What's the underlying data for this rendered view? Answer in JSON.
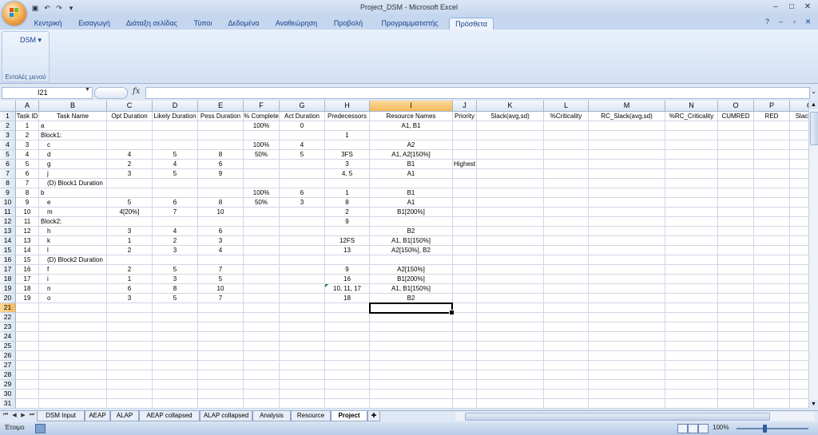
{
  "window": {
    "title": "Project_DSM - Microsoft Excel"
  },
  "ribbon": {
    "tabs": [
      "Κεντρική",
      "Εισαγωγή",
      "Διάταξη σελίδας",
      "Τύποι",
      "Δεδομένα",
      "Αναθεώρηση",
      "Προβολή",
      "Προγραμματιστής",
      "Πρόσθετα"
    ],
    "active_tab": "Πρόσθετα",
    "dsm_button": "DSM",
    "group_label": "Εντολές μενού"
  },
  "formula_bar": {
    "name_box": "I21",
    "fx": "fx",
    "formula": ""
  },
  "columns": [
    "A",
    "B",
    "C",
    "D",
    "E",
    "F",
    "G",
    "H",
    "I",
    "J",
    "K",
    "L",
    "M",
    "N",
    "O",
    "P",
    "Q"
  ],
  "selected_column": "I",
  "selected_row": 21,
  "row_count": 31,
  "rows": [
    [
      "Task ID",
      "Task Name",
      "Opt Duration",
      "Likely Duration",
      "Pess Duration",
      "% Complete",
      "Act Duration",
      "Predecessors",
      "Resource Names",
      "Priority",
      "Slack(avg,sd)",
      "%Criticality",
      "RC_Slack(avg,sd)",
      "%RC_Criticality",
      "CUMRED",
      "RED",
      "Slack/Suc"
    ],
    [
      "1",
      "a",
      "",
      "",
      "",
      "100%",
      "0",
      "",
      "A1, B1",
      "",
      "",
      "",
      "",
      "",
      "",
      "",
      ""
    ],
    [
      "2",
      "Block1:",
      "",
      "",
      "",
      "",
      "",
      "1",
      "",
      "",
      "",
      "",
      "",
      "",
      "",
      "",
      ""
    ],
    [
      "3",
      "c",
      "",
      "",
      "",
      "100%",
      "4",
      "",
      "A2",
      "",
      "",
      "",
      "",
      "",
      "",
      "",
      ""
    ],
    [
      "4",
      "d",
      "4",
      "5",
      "8",
      "50%",
      "5",
      "3FS",
      "A1, A2[150%]",
      "",
      "",
      "",
      "",
      "",
      "",
      "",
      ""
    ],
    [
      "5",
      "g",
      "2",
      "4",
      "6",
      "",
      "",
      "3",
      "B1",
      "Highest",
      "",
      "",
      "",
      "",
      "",
      "",
      ""
    ],
    [
      "6",
      "j",
      "3",
      "5",
      "9",
      "",
      "",
      "4, 5",
      "A1",
      "",
      "",
      "",
      "",
      "",
      "",
      "",
      ""
    ],
    [
      "7",
      "(D) Block1 Duration",
      "",
      "",
      "",
      "",
      "",
      "",
      "",
      "",
      "",
      "",
      "",
      "",
      "",
      "",
      ""
    ],
    [
      "8",
      "b",
      "",
      "",
      "",
      "100%",
      "6",
      "1",
      "B1",
      "",
      "",
      "",
      "",
      "",
      "",
      "",
      ""
    ],
    [
      "9",
      "e",
      "5",
      "6",
      "8",
      "50%",
      "3",
      "8",
      "A1",
      "",
      "",
      "",
      "",
      "",
      "",
      "",
      ""
    ],
    [
      "10",
      "m",
      "4[20%]",
      "7",
      "10",
      "",
      "",
      "2",
      "B1[200%]",
      "",
      "",
      "",
      "",
      "",
      "",
      "",
      ""
    ],
    [
      "11",
      "Block2:",
      "",
      "",
      "",
      "",
      "",
      "9",
      "",
      "",
      "",
      "",
      "",
      "",
      "",
      "",
      ""
    ],
    [
      "12",
      "h",
      "3",
      "4",
      "6",
      "",
      "",
      "",
      "B2",
      "",
      "",
      "",
      "",
      "",
      "",
      "",
      ""
    ],
    [
      "13",
      "k",
      "1",
      "2",
      "3",
      "",
      "",
      "12FS",
      "A1, B1[150%]",
      "",
      "",
      "",
      "",
      "",
      "",
      "",
      ""
    ],
    [
      "14",
      "l",
      "2",
      "3",
      "4",
      "",
      "",
      "13",
      "A2[150%], B2",
      "",
      "",
      "",
      "",
      "",
      "",
      "",
      ""
    ],
    [
      "15",
      "(D) Block2 Duration",
      "",
      "",
      "",
      "",
      "",
      "",
      "",
      "",
      "",
      "",
      "",
      "",
      "",
      "",
      ""
    ],
    [
      "16",
      "f",
      "2",
      "5",
      "7",
      "",
      "",
      "9",
      "A2[150%]",
      "",
      "",
      "",
      "",
      "",
      "",
      "",
      ""
    ],
    [
      "17",
      "i",
      "1",
      "3",
      "5",
      "",
      "",
      "16",
      "B1[200%]",
      "",
      "",
      "",
      "",
      "",
      "",
      "",
      ""
    ],
    [
      "18",
      "n",
      "6",
      "8",
      "10",
      "",
      "",
      "10, 11, 17",
      "A1, B1[150%]",
      "",
      "",
      "",
      "",
      "",
      "",
      "",
      ""
    ],
    [
      "19",
      "o",
      "3",
      "5",
      "7",
      "",
      "",
      "18",
      "B2",
      "",
      "",
      "",
      "",
      "",
      "",
      "",
      ""
    ]
  ],
  "sheets": [
    "DSM Input",
    "AEAP",
    "ALAP",
    "AEAP collapsed",
    "ALAP collapsed",
    "Analysis",
    "Resource",
    "Project"
  ],
  "active_sheet": "Project",
  "status": {
    "ready": "Έτοιμο",
    "zoom": "100%"
  }
}
